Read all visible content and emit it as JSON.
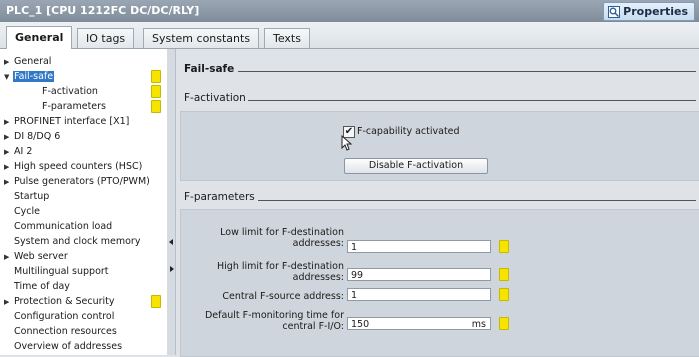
{
  "window": {
    "title": "PLC_1 [CPU 1212FC DC/DC/RLY]",
    "properties_label": "Properties"
  },
  "tabs": [
    {
      "label": "General",
      "active": true
    },
    {
      "label": "IO tags",
      "active": false
    },
    {
      "label": "System constants",
      "active": false
    },
    {
      "label": "Texts",
      "active": false
    }
  ],
  "tree": [
    {
      "label": "General",
      "expander": "collapsed",
      "indent": 0,
      "marker": false
    },
    {
      "label": "Fail-safe",
      "expander": "expanded",
      "indent": 0,
      "marker": true,
      "selected": true
    },
    {
      "label": "F-activation",
      "expander": "none",
      "indent": 2,
      "marker": true
    },
    {
      "label": "F-parameters",
      "expander": "none",
      "indent": 2,
      "marker": true
    },
    {
      "label": "PROFINET interface [X1]",
      "expander": "collapsed",
      "indent": 0,
      "marker": false
    },
    {
      "label": "DI 8/DQ 6",
      "expander": "collapsed",
      "indent": 0,
      "marker": false
    },
    {
      "label": "AI 2",
      "expander": "collapsed",
      "indent": 0,
      "marker": false
    },
    {
      "label": "High speed counters (HSC)",
      "expander": "collapsed",
      "indent": 0,
      "marker": false
    },
    {
      "label": "Pulse generators (PTO/PWM)",
      "expander": "collapsed",
      "indent": 0,
      "marker": false
    },
    {
      "label": "Startup",
      "expander": "none",
      "indent": 0,
      "marker": false
    },
    {
      "label": "Cycle",
      "expander": "none",
      "indent": 0,
      "marker": false
    },
    {
      "label": "Communication load",
      "expander": "none",
      "indent": 0,
      "marker": false
    },
    {
      "label": "System and clock memory",
      "expander": "none",
      "indent": 0,
      "marker": false
    },
    {
      "label": "Web server",
      "expander": "collapsed",
      "indent": 0,
      "marker": false
    },
    {
      "label": "Multilingual support",
      "expander": "none",
      "indent": 0,
      "marker": false
    },
    {
      "label": "Time of day",
      "expander": "none",
      "indent": 0,
      "marker": false
    },
    {
      "label": "Protection & Security",
      "expander": "collapsed",
      "indent": 0,
      "marker": true
    },
    {
      "label": "Configuration control",
      "expander": "none",
      "indent": 0,
      "marker": false
    },
    {
      "label": "Connection resources",
      "expander": "none",
      "indent": 0,
      "marker": false
    },
    {
      "label": "Overview of addresses",
      "expander": "none",
      "indent": 0,
      "marker": false
    }
  ],
  "main": {
    "failsafe_heading": "Fail-safe",
    "factivation_heading": "F-activation",
    "fcapability_label": "F-capability activated",
    "fcapability_checked": true,
    "disable_button_label": "Disable F-activation",
    "fparameters_heading": "F-parameters",
    "fields": [
      {
        "label": "Low limit for F-destination addresses:",
        "value": "1",
        "unit": ""
      },
      {
        "label": "High limit for F-destination addresses:",
        "value": "99",
        "unit": ""
      },
      {
        "label": "Central F-source address:",
        "value": "1",
        "unit": ""
      },
      {
        "label": "Default F-monitoring time for central F-I/O:",
        "value": "150",
        "unit": "ms"
      }
    ]
  },
  "colors": {
    "marker": "#f6e400",
    "selection": "#3178c6"
  }
}
